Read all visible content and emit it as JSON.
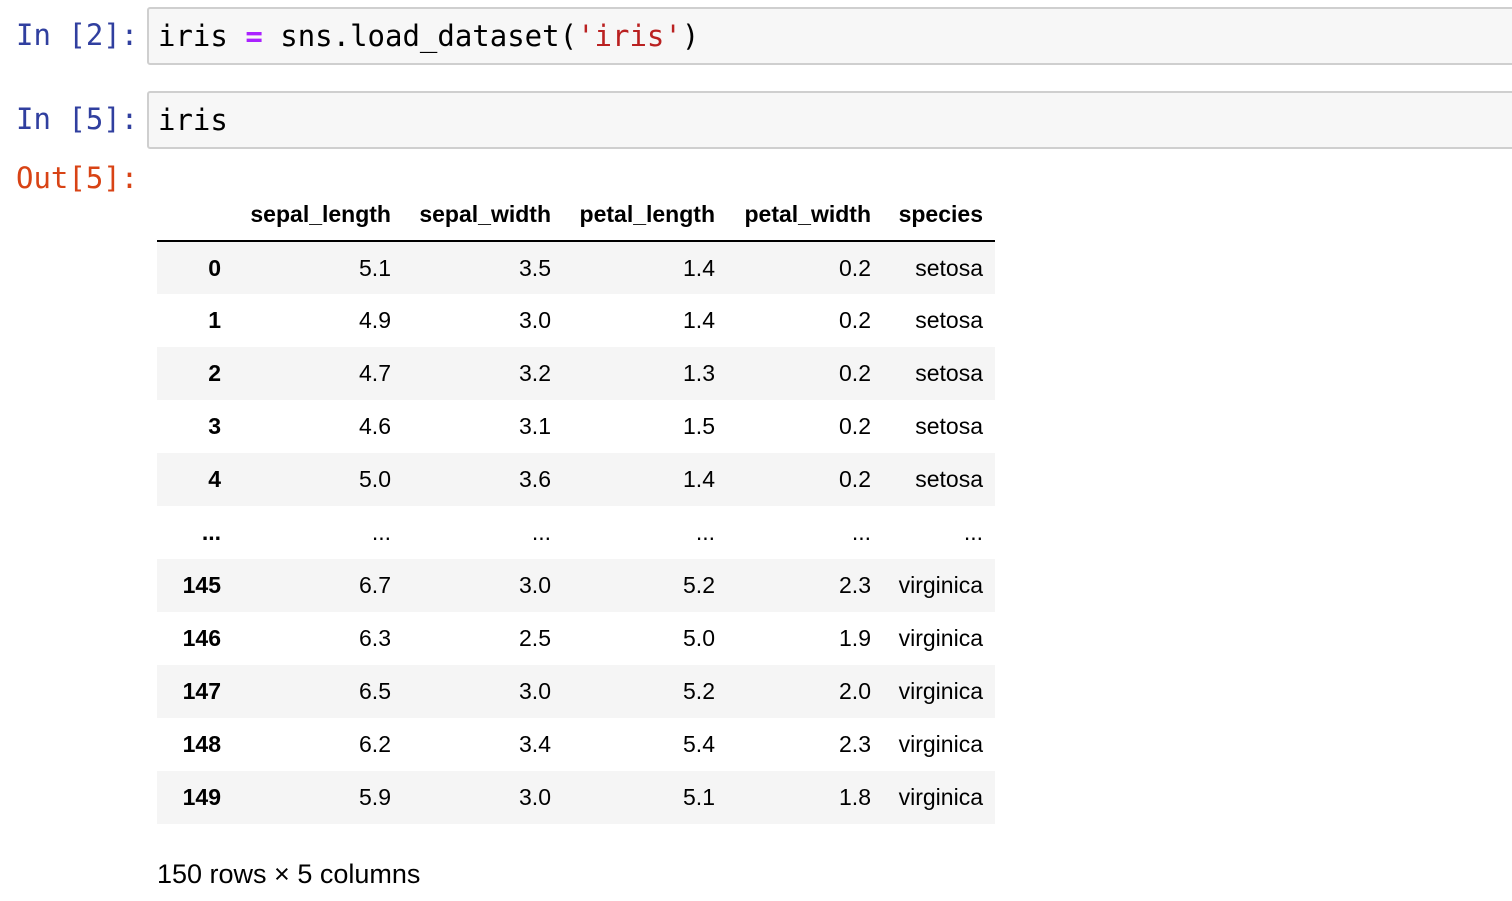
{
  "cells": [
    {
      "prompt": "In [2]:",
      "code": {
        "var": "iris",
        "op": "=",
        "call": "sns.load_dataset(",
        "arg": "'iris'",
        "close": ")"
      }
    },
    {
      "prompt": "In [5]:",
      "code_text": "iris",
      "out_prompt": "Out[5]:"
    }
  ],
  "dataframe": {
    "columns": [
      "",
      "sepal_length",
      "sepal_width",
      "petal_length",
      "petal_width",
      "species"
    ],
    "rows": [
      [
        "0",
        "5.1",
        "3.5",
        "1.4",
        "0.2",
        "setosa"
      ],
      [
        "1",
        "4.9",
        "3.0",
        "1.4",
        "0.2",
        "setosa"
      ],
      [
        "2",
        "4.7",
        "3.2",
        "1.3",
        "0.2",
        "setosa"
      ],
      [
        "3",
        "4.6",
        "3.1",
        "1.5",
        "0.2",
        "setosa"
      ],
      [
        "4",
        "5.0",
        "3.6",
        "1.4",
        "0.2",
        "setosa"
      ],
      [
        "...",
        "...",
        "...",
        "...",
        "...",
        "..."
      ],
      [
        "145",
        "6.7",
        "3.0",
        "5.2",
        "2.3",
        "virginica"
      ],
      [
        "146",
        "6.3",
        "2.5",
        "5.0",
        "1.9",
        "virginica"
      ],
      [
        "147",
        "6.5",
        "3.0",
        "5.2",
        "2.0",
        "virginica"
      ],
      [
        "148",
        "6.2",
        "3.4",
        "5.4",
        "2.3",
        "virginica"
      ],
      [
        "149",
        "5.9",
        "3.0",
        "5.1",
        "1.8",
        "virginica"
      ]
    ],
    "shape_note": "150 rows × 5 columns"
  },
  "colors": {
    "in_prompt": "#303f9f",
    "out_prompt": "#d84315",
    "operator": "#aa22ff",
    "string": "#ba2121",
    "input_bg": "#f7f7f7",
    "stripe": "#f5f5f5"
  }
}
